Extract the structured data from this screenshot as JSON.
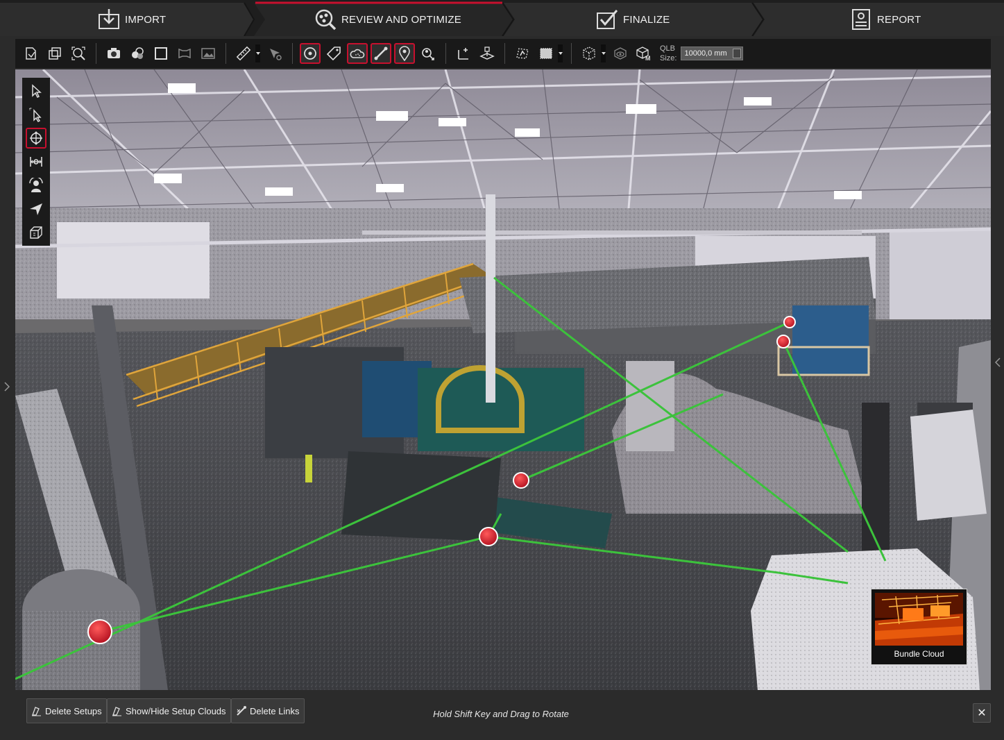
{
  "workflow": {
    "tabs": [
      {
        "label": "IMPORT",
        "icon": "import-icon",
        "active": false
      },
      {
        "label": "REVIEW AND OPTIMIZE",
        "icon": "review-optimize-icon",
        "active": true
      },
      {
        "label": "FINALIZE",
        "icon": "finalize-checkbox-icon",
        "active": false
      },
      {
        "label": "REPORT",
        "icon": "report-document-icon",
        "active": false
      }
    ],
    "accent_color": "#c8102e"
  },
  "toolbar": {
    "groups": [
      [
        "open-project-icon",
        "fit-view-icon",
        "zoom-extents-icon"
      ],
      [
        "camera-icon",
        "color-spheres-icon",
        "square-view-icon",
        "panorama-view-icon",
        "image-view-icon"
      ],
      [
        "measure-ruler-icon",
        "measure-point-icon"
      ],
      [
        "setup-target-icon",
        "tag-icon",
        "cloud-icon",
        "link-icon",
        "location-pin-icon",
        "auto-register-icon"
      ],
      [
        "coordinate-axes-icon",
        "level-plane-icon"
      ],
      [
        "cloud-fence-icon",
        "selection-box-icon"
      ],
      [
        "cube-view-icon",
        "visibility-cube-icon",
        "model-cube-icon"
      ]
    ],
    "active_icons": [
      "setup-target-icon",
      "cloud-icon",
      "link-icon",
      "location-pin-icon"
    ],
    "qlb_label_line1": "QLB",
    "qlb_label_line2": "Size:",
    "qlb_value": "10000,0 mm"
  },
  "left_tools": {
    "items": [
      "select-arrow-icon",
      "multi-select-icon",
      "orbit-icon",
      "pan-icon",
      "walk-icon",
      "fly-icon",
      "cube-icon"
    ],
    "active": "orbit-icon"
  },
  "viewport": {
    "link_color": "#3cc23c",
    "setup_marker_color": "#d8192b"
  },
  "bundle_cloud": {
    "label": "Bundle Cloud"
  },
  "bottombar": {
    "delete_setups": "Delete Setups",
    "show_hide_setup_clouds": "Show/Hide Setup Clouds",
    "delete_links": "Delete Links",
    "hint": "Hold Shift Key and Drag to Rotate",
    "close_label": "✕"
  }
}
